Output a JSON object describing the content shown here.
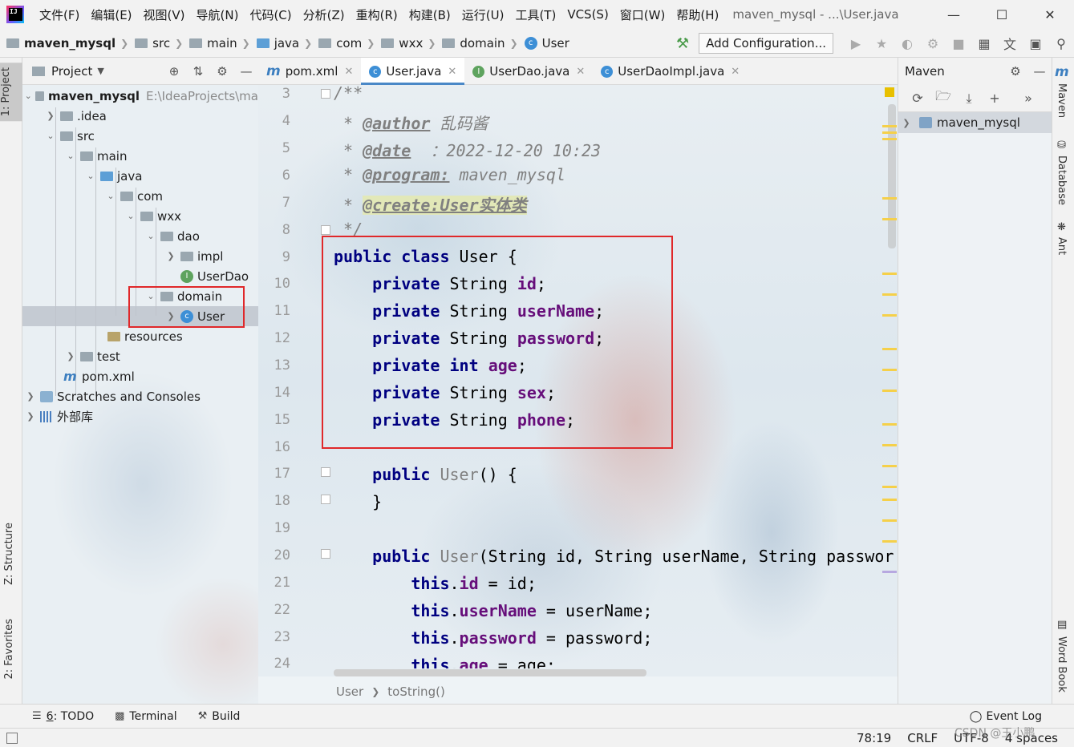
{
  "menubar": {
    "items": [
      "文件(F)",
      "编辑(E)",
      "视图(V)",
      "导航(N)",
      "代码(C)",
      "分析(Z)",
      "重构(R)",
      "构建(B)",
      "运行(U)",
      "工具(T)",
      "VCS(S)",
      "窗口(W)",
      "帮助(H)"
    ],
    "window_title": "maven_mysql - ...\\User.java"
  },
  "navbar": {
    "crumbs": [
      "maven_mysql",
      "src",
      "main",
      "java",
      "com",
      "wxx",
      "domain",
      "User"
    ],
    "add_configuration": "Add Configuration..."
  },
  "left_stripe": {
    "project_tab": "1: Project",
    "structure_tab": "Z: Structure",
    "favorites_tab": "2: Favorites"
  },
  "right_stripe": {
    "maven_tab": "Maven",
    "database_tab": "Database",
    "ant_tab": "Ant",
    "wordbook_tab": "Word Book"
  },
  "project": {
    "title": "Project",
    "root": {
      "label": "maven_mysql",
      "path": "E:\\IdeaProjects\\ma"
    },
    "tree": [
      ".idea",
      "src",
      "main",
      "java",
      "com",
      "wxx",
      "dao",
      "impl",
      "UserDao",
      "domain",
      "User",
      "resources",
      "test",
      "pom.xml",
      "Scratches and Consoles",
      "外部库"
    ]
  },
  "editor": {
    "tabs": [
      "pom.xml",
      "User.java",
      "UserDao.java",
      "UserDaoImpl.java"
    ],
    "active_tab": "User.java",
    "line_numbers": [
      "3",
      "4",
      "5",
      "6",
      "7",
      "8",
      "9",
      "10",
      "11",
      "12",
      "13",
      "14",
      "15",
      "16",
      "17",
      "18",
      "19",
      "20",
      "21",
      "22",
      "23",
      "24"
    ],
    "code": {
      "l3": "/**",
      "l4_tag": "@author",
      "l4_text": " 乱码酱",
      "l5_tag": "@date",
      "l5_text": "  ：2022-12-20 10:23",
      "l6_tag": "@program:",
      "l6_text": " maven_mysql",
      "l7_tag": "@create:User实体类",
      "l8": "*/",
      "l9_kw": "public class",
      "l9_rest": " User {",
      "private": "private",
      "string": "String",
      "int": "int",
      "f_id": "id",
      "f_userName": "userName",
      "f_password": "password",
      "f_age": "age",
      "f_sex": "sex",
      "f_phone": "phone",
      "semi": ";",
      "public": "public",
      "ctor_name": "User",
      "l17_rest": "() {",
      "l18": "}",
      "l20_rest": "(String id, String userName, String passwor",
      "this": "this",
      "l21_rest": " = id;",
      "l22_rest": " = userName;",
      "l23_rest": " = password;",
      "l24_rest": " = age;"
    },
    "breadcrumb": [
      "User",
      "toString()"
    ]
  },
  "maven": {
    "title": "Maven",
    "project": "maven_mysql"
  },
  "bottom_tools": {
    "todo_num": "6",
    "todo_label": ": TODO",
    "terminal": "Terminal",
    "build": "Build",
    "event_log": "Event Log"
  },
  "statusbar": {
    "position": "78:19",
    "line_sep": "CRLF",
    "encoding": "UTF-8",
    "indent": "4 spaces",
    "watermark": "CSDN @王小鹏"
  },
  "colors": {
    "keyword": "#000080",
    "field": "#660e7a",
    "highlight_box": "#e0282a",
    "active_tab_underline": "#4a88c7"
  }
}
